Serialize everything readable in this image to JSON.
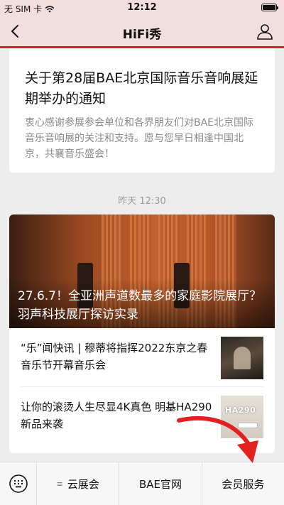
{
  "status_bar": {
    "carrier": "无 SIM 卡",
    "time": "12:12",
    "battery_level": 1.0
  },
  "nav": {
    "title": "HiFi秀",
    "back_icon": "chevron-left-icon",
    "profile_icon": "user-icon"
  },
  "notice": {
    "title": "关于第28届BAE北京国际音乐音响展延期举办的通知",
    "desc": "衷心感谢参展参会单位和各界朋友们对BAE北京国际音乐音响展的关注和支持。愿与您早日相逢中国北京，共襄音乐盛会！"
  },
  "timeline": {
    "label": "昨天 12:30"
  },
  "article": {
    "hero_title": "27.6.7！全亚洲声道数最多的家庭影院展厅？羽声科技展厅探访实录",
    "items": [
      {
        "text": "“乐”闻快讯 | 穆蒂将指挥2022东京之春音乐节开幕音乐会",
        "thumb": "conductor-photo"
      },
      {
        "text": "让你的滚烫人生尽显4K真色 明基HA290新品来袭",
        "thumb": "projector-photo",
        "thumb_label": "HA290"
      }
    ]
  },
  "bottom_menu": {
    "keyboard_icon": "keyboard-icon",
    "items": [
      {
        "label": "云展会",
        "has_submenu": true
      },
      {
        "label": "BAE官网",
        "has_submenu": false
      },
      {
        "label": "会员服务",
        "has_submenu": false
      }
    ]
  },
  "colors": {
    "accent": "#c9262c",
    "nav_bg": "#f2dede",
    "page_bg": "#ededed"
  }
}
